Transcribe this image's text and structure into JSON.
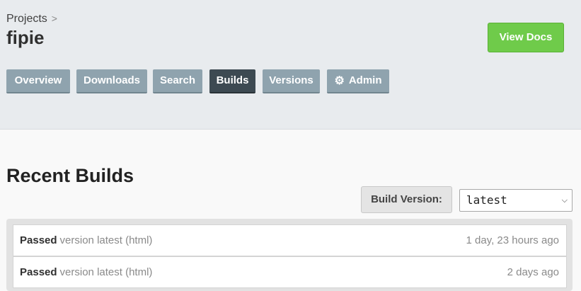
{
  "breadcrumb": {
    "projects_label": "Projects",
    "separator": ">"
  },
  "project": {
    "title": "fipie"
  },
  "view_docs_label": "View Docs",
  "tabs": [
    {
      "label": "Overview",
      "active": false
    },
    {
      "label": "Downloads",
      "active": false
    },
    {
      "label": "Search",
      "active": false
    },
    {
      "label": "Builds",
      "active": true
    },
    {
      "label": "Versions",
      "active": false
    },
    {
      "label": "Admin",
      "active": false,
      "icon": "gear-icon"
    }
  ],
  "recent_builds": {
    "title": "Recent Builds",
    "build_version_label": "Build Version:",
    "selected_version": "latest",
    "rows": [
      {
        "status": "Passed",
        "description": "version latest (html)",
        "time": "1 day, 23 hours ago"
      },
      {
        "status": "Passed",
        "description": "version latest (html)",
        "time": "2 days ago"
      }
    ]
  },
  "colors": {
    "header_bg": "#e8ebee",
    "tab_bg": "#8fa3ae",
    "tab_active_bg": "#3d4a52",
    "view_docs_bg": "#6fcb4a"
  }
}
